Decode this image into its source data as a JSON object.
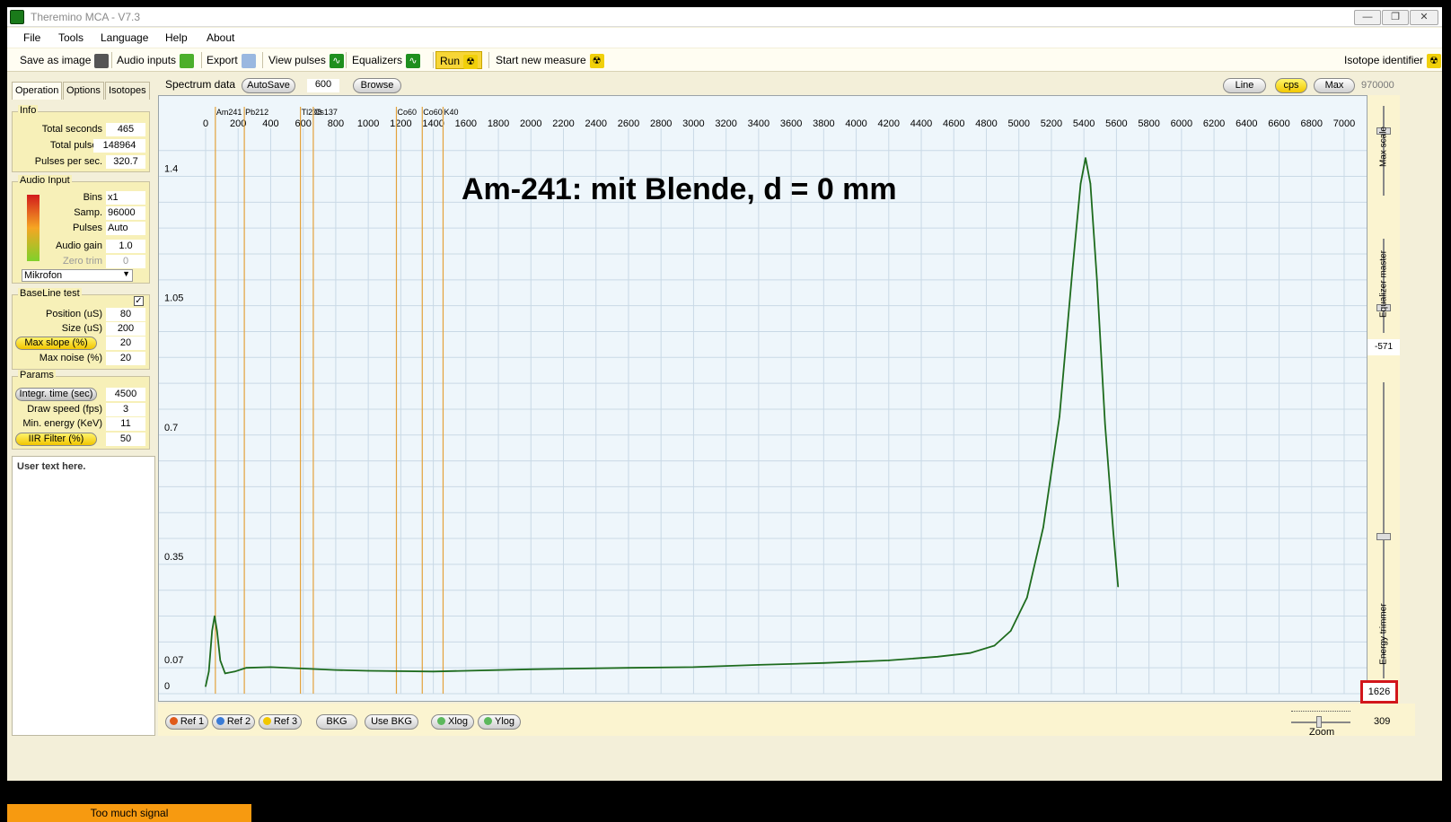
{
  "window": {
    "title": "Theremino MCA - V7.3"
  },
  "menu": [
    "File",
    "Tools",
    "Language",
    "Help",
    "About"
  ],
  "toolbar": {
    "save_image": "Save as image",
    "audio_inputs": "Audio inputs",
    "export": "Export",
    "view_pulses": "View pulses",
    "equalizers": "Equalizers",
    "run": "Run",
    "start_new": "Start new measure",
    "isotope_identifier": "Isotope identifier"
  },
  "tabs": [
    "Operation",
    "Options",
    "Isotopes"
  ],
  "info": {
    "title": "Info",
    "total_seconds_label": "Total seconds",
    "total_seconds": "465",
    "total_pulses_label": "Total pulses",
    "total_pulses": "148964",
    "pps_label": "Pulses per sec.",
    "pps": "320.7"
  },
  "audio_input": {
    "title": "Audio Input",
    "bins_label": "Bins",
    "bins": "x1",
    "samp_label": "Samp.",
    "samp": "96000",
    "pulses_label": "Pulses",
    "pulses": "Auto",
    "gain_label": "Audio gain",
    "gain": "1.0",
    "zero_trim_label": "Zero trim",
    "zero_trim": "0",
    "device": "Mikrofon"
  },
  "baseline": {
    "title": "BaseLine test",
    "position_label": "Position (uS)",
    "position": "80",
    "size_label": "Size (uS)",
    "size": "200",
    "max_slope_label": "Max slope (%)",
    "max_slope": "20",
    "max_noise_label": "Max noise (%)",
    "max_noise": "20"
  },
  "params": {
    "title": "Params",
    "integr_label": "Integr. time (sec)",
    "integr": "4500",
    "draw_label": "Draw speed (fps)",
    "draw": "3",
    "minE_label": "Min. energy (KeV)",
    "minE": "11",
    "iir_label": "IIR Filter (%)",
    "iir": "50"
  },
  "user_text": "User text here.",
  "status": "Too much signal",
  "spectrum_header": {
    "label": "Spectrum data",
    "autosave": "AutoSave",
    "autosave_value": "600",
    "browse": "Browse",
    "line": "Line",
    "cps": "cps",
    "max": "Max",
    "max_value": "970000"
  },
  "bottom": {
    "ref1": "Ref 1",
    "ref2": "Ref 2",
    "ref3": "Ref 3",
    "bkg": "BKG",
    "use_bkg": "Use BKG",
    "xlog": "Xlog",
    "ylog": "Ylog",
    "zoom_label": "Zoom",
    "zoom_value": "309"
  },
  "right": {
    "max_scale": "Max scale",
    "equalizer_master": "Equalizer master",
    "equalizer_value": "-571",
    "energy_trimmer": "Energy trimmer",
    "energy_value": "1626"
  },
  "colors": {
    "curve": "#1d6b1d",
    "isotope_line": "#e3a23b",
    "grid": "#c9d9e6"
  },
  "chart_data": {
    "type": "line",
    "title": "Am-241: mit Blende, d = 0 mm",
    "xlim": [
      -50,
      7100
    ],
    "ylim": [
      0,
      1.53
    ],
    "x_ticks": [
      0,
      200,
      400,
      600,
      800,
      1000,
      1200,
      1400,
      1600,
      1800,
      2000,
      2200,
      2400,
      2600,
      2800,
      3000,
      3200,
      3400,
      3600,
      3800,
      4000,
      4200,
      4400,
      4600,
      4800,
      5000,
      5200,
      5400,
      5600,
      5800,
      6000,
      6200,
      6400,
      6600,
      6800,
      7000
    ],
    "y_ticks": [
      0,
      0.07,
      0.35,
      0.7,
      1.05,
      1.4
    ],
    "isotope_lines": [
      {
        "name": "Am241",
        "x": 60
      },
      {
        "name": "Pb212",
        "x": 238
      },
      {
        "name": "Tl208",
        "x": 583
      },
      {
        "name": "Cs137",
        "x": 662
      },
      {
        "name": "Co60",
        "x": 1173
      },
      {
        "name": "Co60",
        "x": 1332
      },
      {
        "name": "K40",
        "x": 1460
      }
    ],
    "series": [
      {
        "points": [
          [
            0,
            0.02
          ],
          [
            20,
            0.06
          ],
          [
            40,
            0.17
          ],
          [
            55,
            0.21
          ],
          [
            70,
            0.17
          ],
          [
            90,
            0.09
          ],
          [
            120,
            0.055
          ],
          [
            180,
            0.06
          ],
          [
            250,
            0.07
          ],
          [
            400,
            0.072
          ],
          [
            600,
            0.068
          ],
          [
            800,
            0.064
          ],
          [
            1000,
            0.062
          ],
          [
            1400,
            0.06
          ],
          [
            2000,
            0.066
          ],
          [
            2600,
            0.07
          ],
          [
            3000,
            0.072
          ],
          [
            3400,
            0.078
          ],
          [
            3800,
            0.083
          ],
          [
            4200,
            0.09
          ],
          [
            4500,
            0.1
          ],
          [
            4700,
            0.11
          ],
          [
            4850,
            0.13
          ],
          [
            4950,
            0.17
          ],
          [
            5050,
            0.26
          ],
          [
            5150,
            0.45
          ],
          [
            5250,
            0.75
          ],
          [
            5330,
            1.15
          ],
          [
            5380,
            1.38
          ],
          [
            5410,
            1.45
          ],
          [
            5440,
            1.38
          ],
          [
            5480,
            1.12
          ],
          [
            5530,
            0.73
          ],
          [
            5580,
            0.44
          ],
          [
            5610,
            0.29
          ]
        ]
      }
    ]
  }
}
